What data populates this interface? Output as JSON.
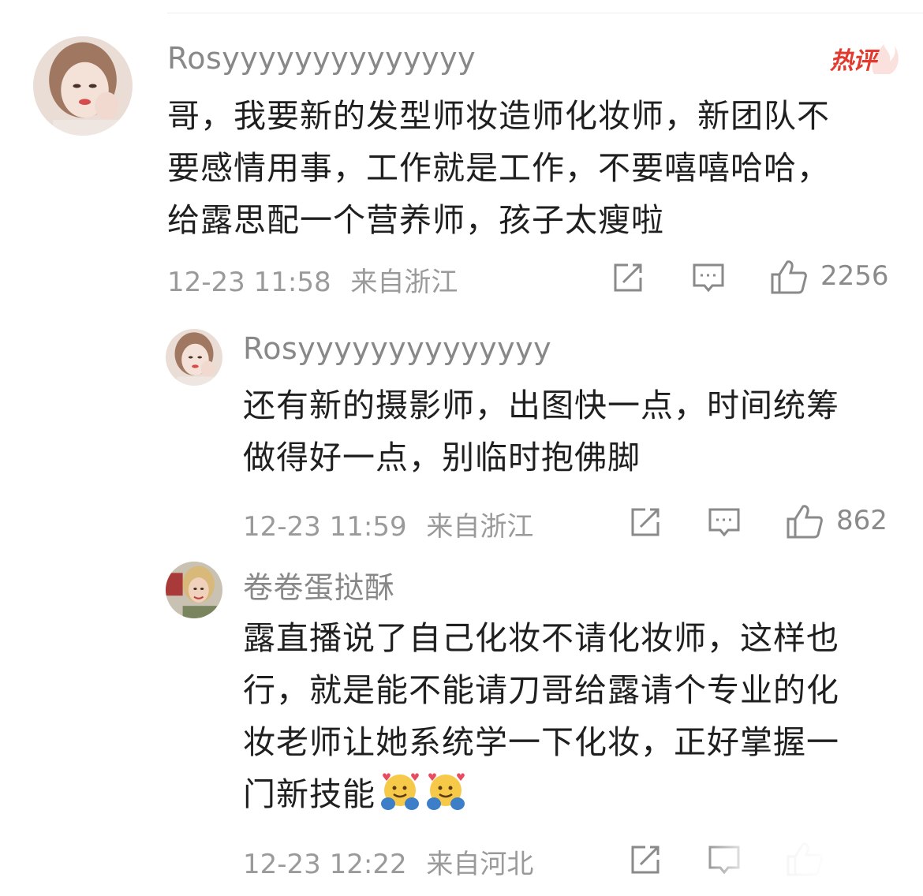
{
  "hot_badge": "热评",
  "comments": [
    {
      "username": "Rosyyyyyyyyyyyyyy",
      "lines": [
        "哥，我要新的发型师妆造师化妆师，新团队不",
        "要感情用事，工作就是工作，不要嘻嘻哈哈，",
        "给露思配一个营养师，孩子太瘦啦"
      ],
      "time": "12-23 11:58",
      "location": "来自浙江",
      "likes": "2256"
    },
    {
      "username": "Rosyyyyyyyyyyyyyy",
      "lines": [
        "还有新的摄影师，出图快一点，时间统筹",
        "做得好一点，别临时抱佛脚"
      ],
      "time": "12-23 11:59",
      "location": "来自浙江",
      "likes": "862"
    },
    {
      "username": "卷卷蛋挞酥",
      "lines": [
        "露直播说了自己化妆不请化妆师，这样也",
        "行，就是能不能请刀哥给露请个专业的化",
        "妆老师让她系统学一下化妆，正好掌握一",
        "门新技能"
      ],
      "time": "12-23 12:22",
      "location": "来自河北",
      "likes": ""
    }
  ],
  "icons": {
    "repost": "repost-icon",
    "comment": "comment-icon",
    "like": "thumbs-up-icon",
    "emoji": "hugging-face-emoji"
  },
  "colors": {
    "hot_badge": "#e23a2e",
    "meta_text": "#9a9a9a",
    "username": "#888888",
    "body_text": "#1f1f1f"
  }
}
